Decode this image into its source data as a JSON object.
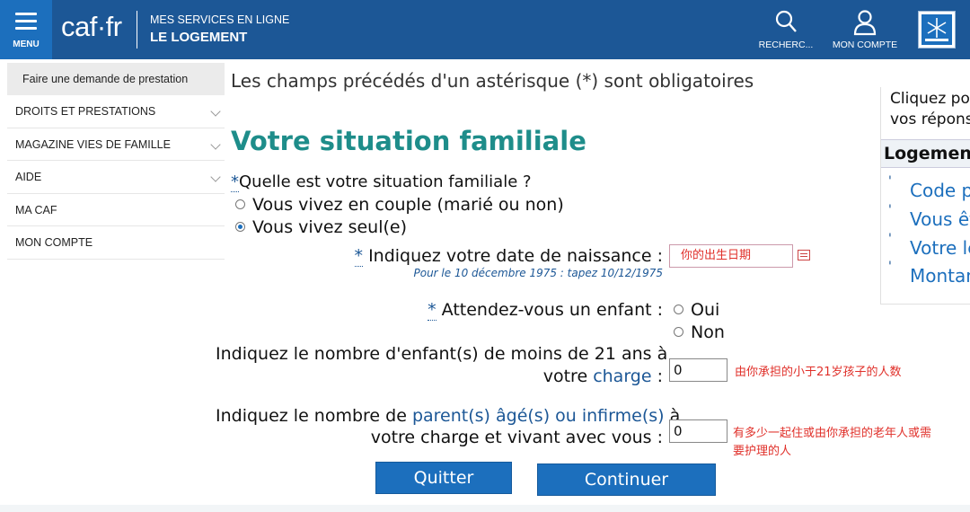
{
  "header": {
    "menu_label": "MENU",
    "logo": "caf·fr",
    "service_line1": "MES SERVICES EN LIGNE",
    "service_line2": "LE LOGEMENT",
    "search_label": "RECHERC...",
    "account_label": "MON COMPTE",
    "colors": {
      "bar": "#1c5796",
      "menu": "#1c6fbd"
    }
  },
  "sidebar": {
    "items": [
      {
        "label": "Faire une demande de prestation",
        "chevron": false
      },
      {
        "label": "DROITS ET PRESTATIONS",
        "chevron": true
      },
      {
        "label": "MAGAZINE VIES DE FAMILLE",
        "chevron": true
      },
      {
        "label": "AIDE",
        "chevron": true
      },
      {
        "label": "MA CAF",
        "chevron": false
      },
      {
        "label": "MON COMPTE",
        "chevron": false
      }
    ]
  },
  "form": {
    "mandatory_note": "Les champs précédés d'un astérisque (*) sont obligatoires",
    "title": "Votre situation familiale",
    "star": "*",
    "q_situation": "Quelle est votre situation familiale ?",
    "options_situation": [
      {
        "label": "Vous vivez en couple (marié ou non)",
        "selected": false
      },
      {
        "label": "Vous vivez seul(e)",
        "selected": true
      }
    ],
    "birth_label": " Indiquez votre date de naissance :",
    "birth_hint": "Pour le 10 décembre 1975 : tapez 10/12/1975",
    "birth_value": "你的出生日期",
    "child_label": " Attendez-vous un enfant :",
    "options_child": [
      {
        "label": "Oui",
        "selected": false
      },
      {
        "label": "Non",
        "selected": false
      }
    ],
    "children_label_1": "Indiquez le nombre d'enfant(s) de moins de 21 ans à",
    "children_label_2a": "votre ",
    "children_label_2b": "charge",
    "children_label_2c": " :",
    "children_value": "0",
    "children_note": "由你承担的小于21岁孩子的人数",
    "parents_label_1a": "Indiquez le nombre de ",
    "parents_label_1b": "parent(s) âgé(s) ou infirme(s)",
    "parents_label_1c": " à",
    "parents_label_2": "votre charge et vivant avec vous :",
    "parents_value": "0",
    "parents_note_1": "有多少一起住或由你承担的老年人或需",
    "parents_note_2": "要护理的人",
    "btn_quit": "Quitter",
    "btn_continue": "Continuer"
  },
  "right_panel": {
    "text_line1": "Cliquez po",
    "text_line2": "vos répons",
    "heading": "Logement",
    "links": [
      "Code p",
      "Vous êt",
      "Votre le",
      "Montan"
    ]
  }
}
